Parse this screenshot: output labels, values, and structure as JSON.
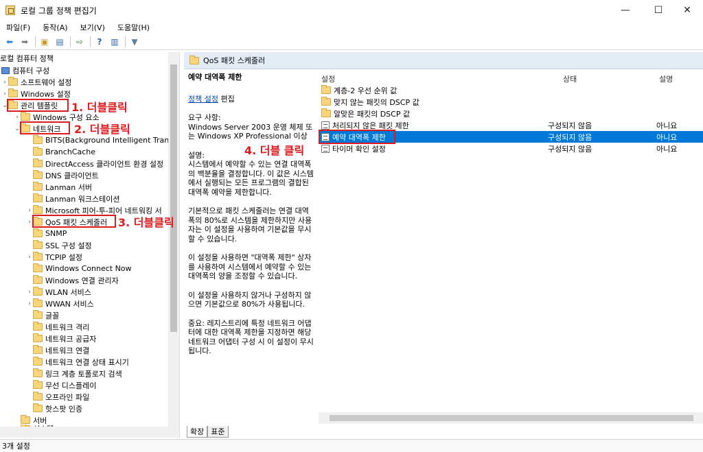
{
  "window": {
    "title": "로컬 그룹 정책 편집기",
    "minimize": "—",
    "maximize": "☐",
    "close": "✕"
  },
  "menu": [
    "파일(F)",
    "동작(A)",
    "보기(V)",
    "도움말(H)"
  ],
  "tree": {
    "root": "로컬 컴퓨터 정책",
    "computer_config": "컴퓨터 구성",
    "software_settings": "소프트웨어 설정",
    "windows_settings": "Windows 설정",
    "admin_templates": "관리 템플릿",
    "windows_components": "Windows 구성 요소",
    "network": "네트워크",
    "children": [
      "BITS(Background Intelligent Transfer",
      "BranchCache",
      "DirectAccess 클라이언트 환경 설정",
      "DNS 클라이언트",
      "Lanman 서버",
      "Lanman 워크스테이션",
      "Microsoft 피어-투-피어 네트워킹 서",
      "QoS 패킷 스케줄러",
      "SNMP",
      "SSL 구성 설정",
      "TCPIP 설정",
      "Windows Connect Now",
      "Windows 연결 관리자",
      "WLAN 서비스",
      "WWAN 서비스",
      "글꼴",
      "네트워크 격리",
      "네트워크 공급자",
      "네트워크 연결",
      "네트워크 연결 상태 표시기",
      "링크 계층 토폴로지 검색",
      "무선 디스플레이",
      "오프라인 파일",
      "핫스팟 인증"
    ],
    "server": "서버",
    "system": "시스템"
  },
  "annotations": {
    "step1": "1. 더블클릭",
    "step2": "2. 더블클릭",
    "step3": "3. 더블클릭",
    "step4": "4. 더블 클릭"
  },
  "header_title": "QoS 패킷 스케줄러",
  "description": {
    "title": "예약 대역폭 제한",
    "edit_link": "정책 설정",
    "edit_suffix": " 편집",
    "requirements": "요구 사항:\nWindows Server 2003 운영 체제 또는 Windows XP Professional 이상",
    "desc_label": "설명:",
    "desc1": "시스템에서 예약할 수 있는 연결 대역폭의 백분율을 결정합니다. 이 값은 시스템에서 실행되는 모든 프로그램의 결합된 대역폭 예약을 제한합니다.",
    "desc2": "기본적으로 패킷 스케줄러는 연결 대역폭의 80%로 시스템을 제한하지만 사용자는 이 설정을 사용하여 기본값을 무시할 수 있습니다.",
    "desc3": "이 설정을 사용하면 \"대역폭 제한\" 상자를 사용하여 시스템에서 예약할 수 있는 대역폭의 양을 조정할 수 있습니다.",
    "desc4": "이 설정을 사용하지 않거나 구성하지 않으면 기본값으로 80%가 사용됩니다.",
    "desc5": "중요: 레지스트리에 특정 네트워크 어댑터에 대한 대역폭 제한을 지정하면 해당 네트워크 어댑터 구성 시 이 설정이 무시됩니다."
  },
  "list": {
    "col_setting": "설정",
    "col_state": "상태",
    "col_note": "설명",
    "folders": [
      "계층-2 우선 순위 값",
      "맞지 않는 패킷의 DSCP 값",
      "알맞은 패킷의 DSCP 값"
    ],
    "settings": [
      {
        "name": "처리되지 않은 패킷 제한",
        "state": "구성되지 않음",
        "note": "아니요"
      },
      {
        "name": "예약 대역폭 제한",
        "state": "구성되지 않음",
        "note": "아니요"
      },
      {
        "name": "타이머 확인 설정",
        "state": "구성되지 않음",
        "note": "아니요"
      }
    ]
  },
  "tabs": [
    "확장",
    "표준"
  ],
  "status": "3개 설정"
}
